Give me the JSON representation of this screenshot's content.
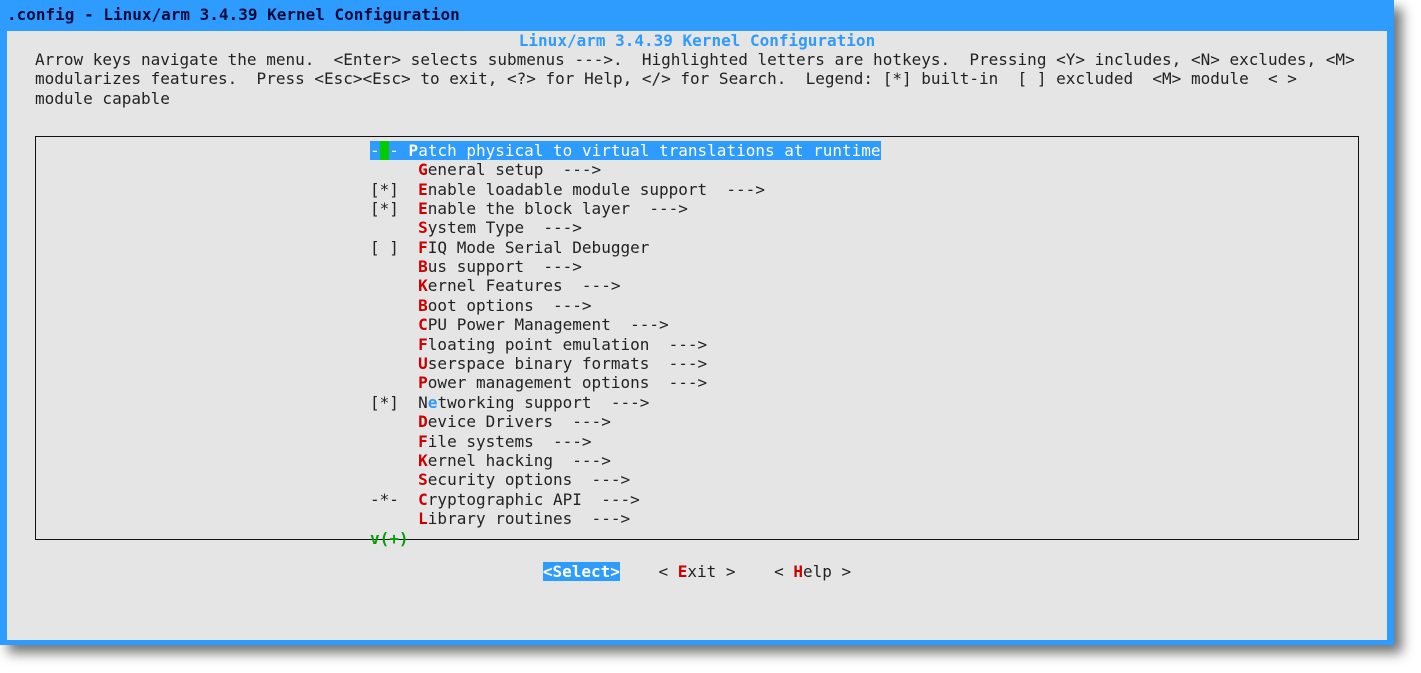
{
  "window_title": ".config - Linux/arm 3.4.39 Kernel Configuration",
  "kc_title": "Linux/arm 3.4.39 Kernel Configuration",
  "help": "Arrow keys navigate the menu.  <Enter> selects submenus --->.  Highlighted letters are hotkeys.  Pressing <Y> includes, <N> excludes, <M> modularizes features.  Press <Esc><Esc> to exit, <?> for Help, </> for Search.  Legend: [*] built-in  [ ] excluded  <M> module  < > module capable",
  "scroll_indicator": "v(+)",
  "menu": [
    {
      "mark": "- -",
      "hotkey": "P",
      "label": "atch physical to virtual translations at runtime",
      "arrow": false,
      "selected": true,
      "hkstyle": "red"
    },
    {
      "mark": "   ",
      "hotkey": "G",
      "label": "eneral setup",
      "arrow": true,
      "selected": false,
      "hkstyle": "red"
    },
    {
      "mark": "[*]",
      "hotkey": "E",
      "label": "nable loadable module support",
      "arrow": true,
      "selected": false,
      "hkstyle": "red"
    },
    {
      "mark": "[*]",
      "hotkey": "E",
      "label": "nable the block layer",
      "arrow": true,
      "selected": false,
      "hkstyle": "red"
    },
    {
      "mark": "   ",
      "hotkey": "S",
      "label": "ystem Type",
      "arrow": true,
      "selected": false,
      "hkstyle": "red"
    },
    {
      "mark": "[ ]",
      "hotkey": "F",
      "label": "IQ Mode Serial Debugger",
      "arrow": false,
      "selected": false,
      "hkstyle": "red"
    },
    {
      "mark": "   ",
      "hotkey": "B",
      "label": "us support",
      "arrow": true,
      "selected": false,
      "hkstyle": "red"
    },
    {
      "mark": "   ",
      "hotkey": "K",
      "label": "ernel Features",
      "arrow": true,
      "selected": false,
      "hkstyle": "red"
    },
    {
      "mark": "   ",
      "hotkey": "B",
      "label": "oot options",
      "arrow": true,
      "selected": false,
      "hkstyle": "red"
    },
    {
      "mark": "   ",
      "hotkey": "C",
      "label": "PU Power Management",
      "arrow": true,
      "selected": false,
      "hkstyle": "red"
    },
    {
      "mark": "   ",
      "hotkey": "F",
      "label": "loating point emulation",
      "arrow": true,
      "selected": false,
      "hkstyle": "red"
    },
    {
      "mark": "   ",
      "hotkey": "U",
      "label": "serspace binary formats",
      "arrow": true,
      "selected": false,
      "hkstyle": "red"
    },
    {
      "mark": "   ",
      "hotkey": "P",
      "label": "ower management options",
      "arrow": true,
      "selected": false,
      "hkstyle": "red"
    },
    {
      "mark": "[*]",
      "hotkey": "e",
      "pre": "N",
      "label": "tworking support",
      "arrow": true,
      "selected": false,
      "hkstyle": "blue"
    },
    {
      "mark": "   ",
      "hotkey": "D",
      "label": "evice Drivers",
      "arrow": true,
      "selected": false,
      "hkstyle": "red"
    },
    {
      "mark": "   ",
      "hotkey": "F",
      "label": "ile systems",
      "arrow": true,
      "selected": false,
      "hkstyle": "red"
    },
    {
      "mark": "   ",
      "hotkey": "K",
      "label": "ernel hacking",
      "arrow": true,
      "selected": false,
      "hkstyle": "red"
    },
    {
      "mark": "   ",
      "hotkey": "S",
      "label": "ecurity options",
      "arrow": true,
      "selected": false,
      "hkstyle": "red"
    },
    {
      "mark": "-*-",
      "hotkey": "C",
      "label": "ryptographic API",
      "arrow": true,
      "selected": false,
      "hkstyle": "red"
    },
    {
      "mark": "   ",
      "hotkey": "L",
      "label": "ibrary routines",
      "arrow": true,
      "selected": false,
      "hkstyle": "red"
    }
  ],
  "buttons": {
    "select": "<Select>",
    "exit_pre": "< ",
    "exit_hk": "E",
    "exit_post": "xit >",
    "help_pre": "< ",
    "help_hk": "H",
    "help_post": "elp >"
  }
}
